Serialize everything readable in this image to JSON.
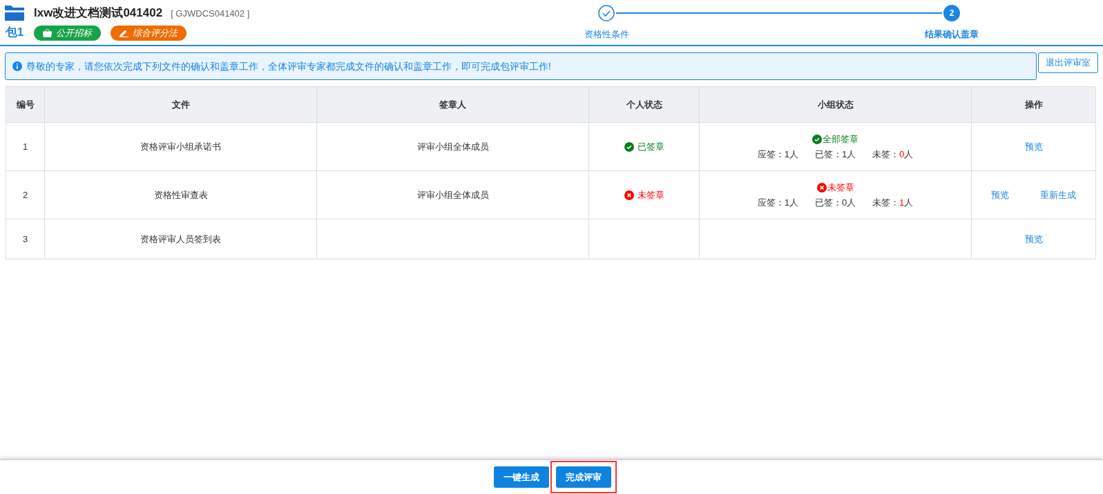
{
  "header": {
    "title": "lxw改进文档测试041402",
    "code": "[ GJWDCS041402 ]",
    "package": "包1",
    "tags": [
      {
        "kind": "procurement",
        "label": "公开招标"
      },
      {
        "kind": "method",
        "label": "综合评分法"
      }
    ]
  },
  "steps": [
    {
      "label": "资格性条件",
      "done": true,
      "selected": false
    },
    {
      "label": "结果确认盖章",
      "number": "2",
      "done": false,
      "selected": true
    }
  ],
  "notice": "尊敬的专家，请您依次完成下列文件的确认和盖章工作，全体评审专家都完成文件的确认和盖章工作，即可完成包评审工作!",
  "exit_button": "退出评审室",
  "table": {
    "columns": [
      "编号",
      "文件",
      "签章人",
      "个人状态",
      "小组状态",
      "操作"
    ],
    "rows": [
      {
        "no": "1",
        "file": "资格评审小组承诺书",
        "signer": "评审小组全体成员",
        "personal": {
          "kind": "signed",
          "text": "已签章"
        },
        "group": {
          "kind": "signed",
          "text": "全部签章",
          "counts": [
            {
              "kind": "due",
              "label": "应签：",
              "value": "1",
              "unit": "人"
            },
            {
              "kind": "signed",
              "label": "已签：",
              "value": "1",
              "unit": "人"
            },
            {
              "kind": "unsigned",
              "label": "未签：",
              "value": "0",
              "unit": "人"
            }
          ]
        },
        "actions": [
          "预览"
        ]
      },
      {
        "no": "2",
        "file": "资格性审查表",
        "signer": "评审小组全体成员",
        "personal": {
          "kind": "unsigned",
          "text": "未签章"
        },
        "group": {
          "kind": "unsigned",
          "text": "未签章",
          "counts": [
            {
              "kind": "due",
              "label": "应签：",
              "value": "1",
              "unit": "人"
            },
            {
              "kind": "signed",
              "label": "已签：",
              "value": "0",
              "unit": "人"
            },
            {
              "kind": "unsigned",
              "label": "未签：",
              "value": "1",
              "unit": "人"
            }
          ]
        },
        "actions": [
          "预览",
          "重新生成"
        ]
      },
      {
        "no": "3",
        "file": "资格评审人员签到表",
        "actions": [
          "预览"
        ]
      }
    ]
  },
  "footer_buttons": [
    {
      "label": "一键生成",
      "highlighted": false
    },
    {
      "label": "完成评审",
      "highlighted": true
    }
  ]
}
